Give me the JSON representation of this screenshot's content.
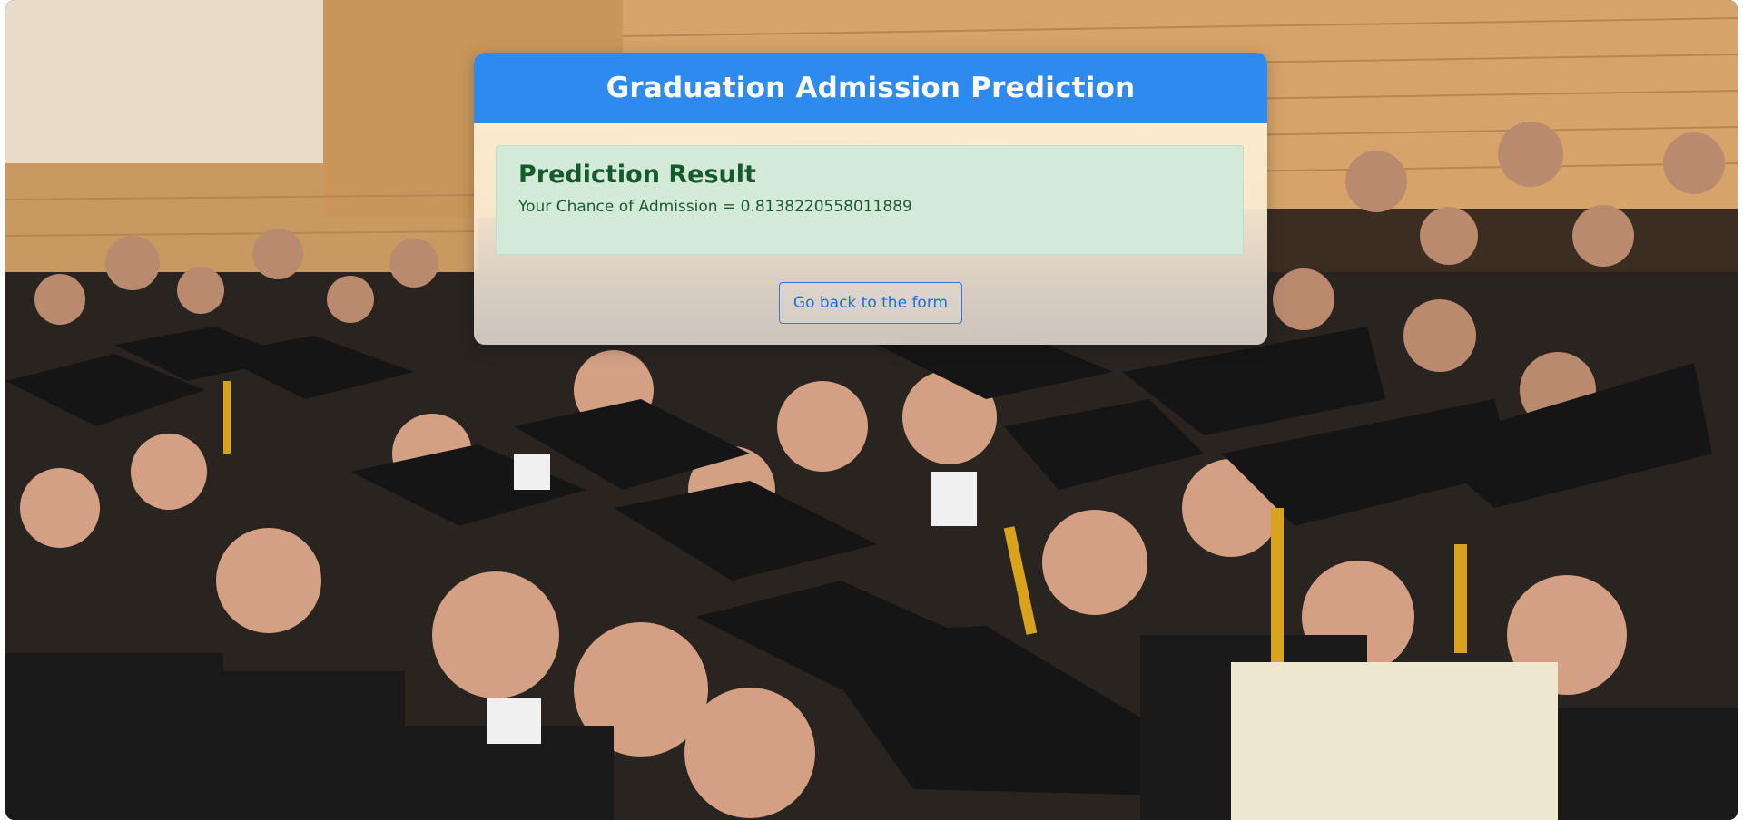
{
  "header": {
    "title": "Graduation Admission Prediction"
  },
  "result": {
    "title": "Prediction Result",
    "text": "Your Chance of Admission = 0.8138220558011889"
  },
  "actions": {
    "back_label": "Go back to the form"
  },
  "colors": {
    "header_bg": "#2f8af0",
    "result_bg": "#d3ead9",
    "result_text": "#145a2c",
    "button_border": "#2f7be0"
  },
  "background": {
    "description_icon": "graduation-crowd-photo"
  }
}
